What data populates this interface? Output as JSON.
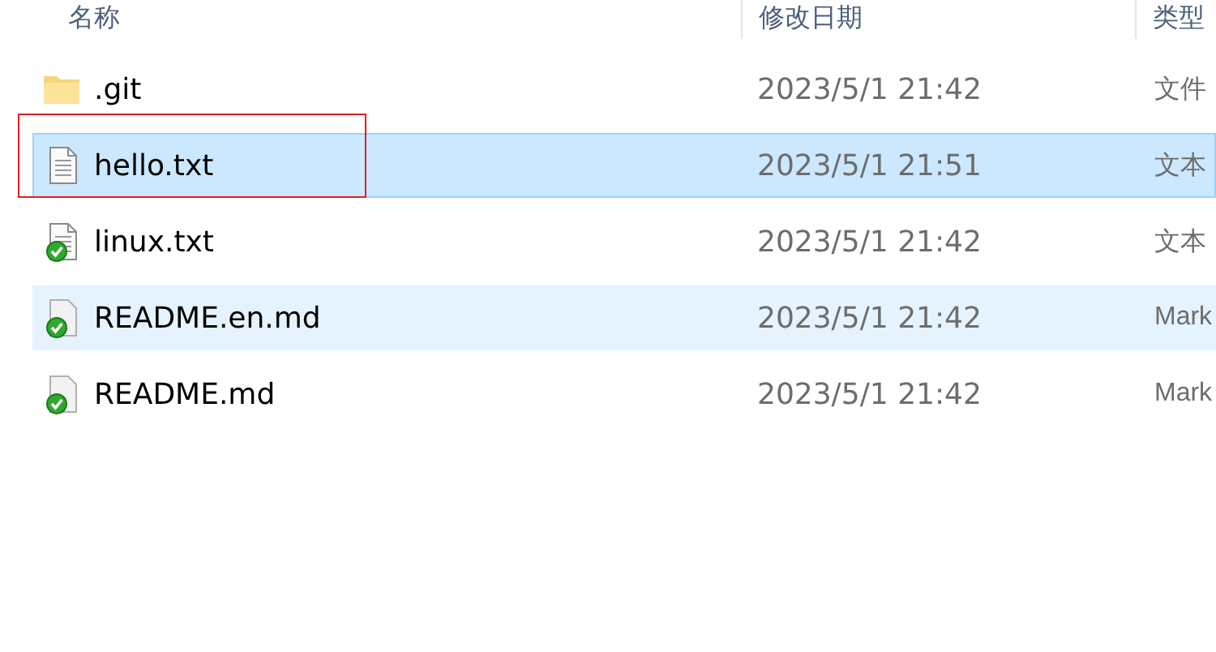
{
  "columns": [
    {
      "label": "名称"
    },
    {
      "label": "修改日期"
    },
    {
      "label": "类型"
    }
  ],
  "files": [
    {
      "name": ".git",
      "modified": "2023/5/1 21:42",
      "type": "文件",
      "kind": "folder",
      "selected": false,
      "hovered": false,
      "annotated": false
    },
    {
      "name": "hello.txt",
      "modified": "2023/5/1 21:51",
      "type": "文本",
      "kind": "text",
      "selected": true,
      "hovered": false,
      "annotated": true
    },
    {
      "name": "linux.txt",
      "modified": "2023/5/1 21:42",
      "type": "文本",
      "kind": "checked-text",
      "selected": false,
      "hovered": false,
      "annotated": false
    },
    {
      "name": "README.en.md",
      "modified": "2023/5/1 21:42",
      "type": "Mark",
      "kind": "checked-file",
      "selected": false,
      "hovered": true,
      "annotated": false
    },
    {
      "name": "README.md",
      "modified": "2023/5/1 21:42",
      "type": "Mark",
      "kind": "checked-file",
      "selected": false,
      "hovered": false,
      "annotated": false
    }
  ]
}
